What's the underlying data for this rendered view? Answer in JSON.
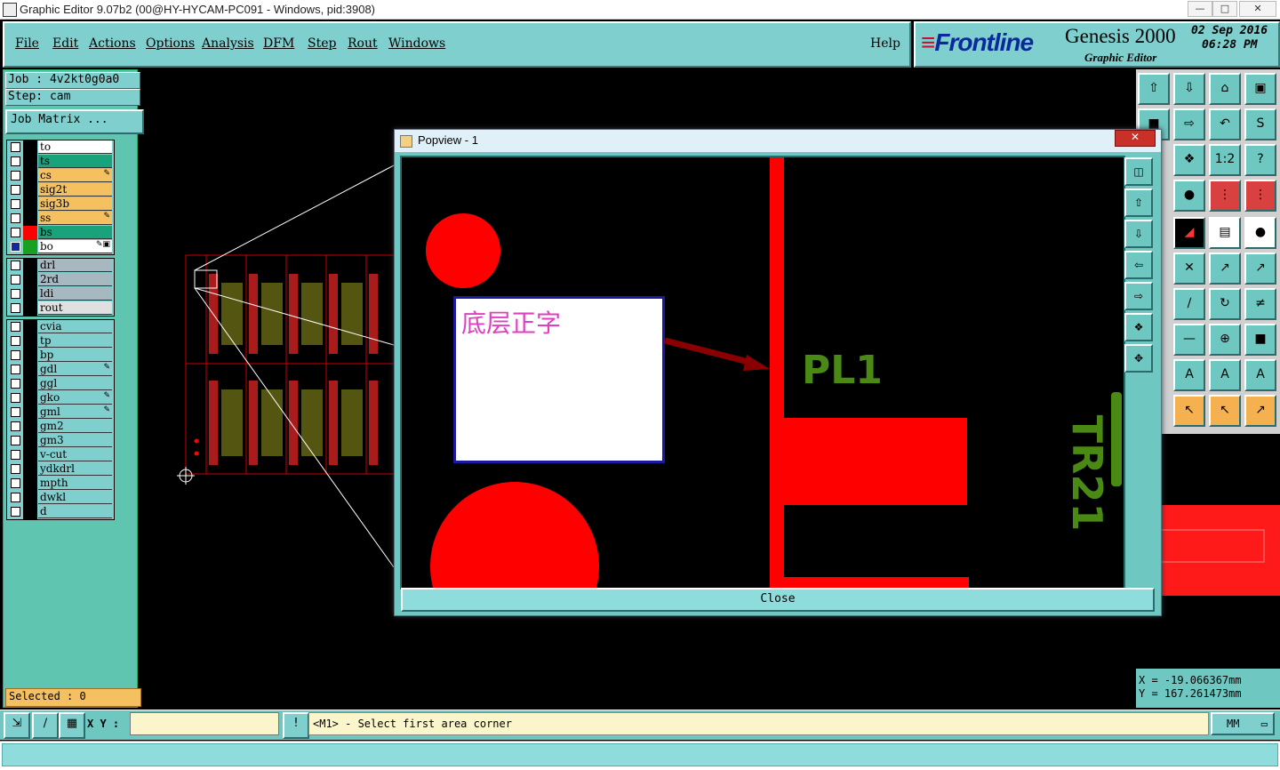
{
  "window": {
    "title": "Graphic Editor 9.07b2 (00@HY-HYCAM-PC091 - Windows, pid:3908)",
    "buttons": [
      "—",
      "□",
      "✕"
    ]
  },
  "menu": {
    "items": [
      "File",
      "Edit",
      "Actions",
      "Options",
      "Analysis",
      "DFM",
      "Step",
      "Rout",
      "Windows"
    ],
    "help": "Help"
  },
  "brand": {
    "logo": "Frontline",
    "product": "Genesis 2000",
    "subtitle": "Graphic Editor",
    "date": "02 Sep 2016",
    "time": "06:28 PM"
  },
  "job": {
    "job_label": "Job : 4v2kt0g0a0",
    "step_label": "Step: cam",
    "matrix_button": "Job Matrix ..."
  },
  "layers": {
    "group1": [
      {
        "name": "to",
        "color": "#ffffff",
        "edit": ""
      },
      {
        "name": "ts",
        "color": "#1aa37a",
        "edit": ""
      },
      {
        "name": "cs",
        "color": "#f5c060",
        "edit": "✎"
      },
      {
        "name": "sig2t",
        "color": "#f5c060",
        "edit": ""
      },
      {
        "name": "sig3b",
        "color": "#f5c060",
        "edit": ""
      },
      {
        "name": "ss",
        "color": "#f5c060",
        "edit": "✎"
      },
      {
        "name": "bs",
        "color": "#1aa37a",
        "edit": ""
      },
      {
        "name": "bo",
        "color": "#ffffff",
        "edit": "✎▣"
      }
    ],
    "group2": [
      {
        "name": "drl",
        "color": "#a8b8c0",
        "edit": ""
      },
      {
        "name": "2rd",
        "color": "#a8b8c0",
        "edit": ""
      },
      {
        "name": "ldi",
        "color": "#a8b8c0",
        "edit": ""
      },
      {
        "name": "rout",
        "color": "#e0e0e0",
        "edit": ""
      }
    ],
    "group3": [
      {
        "name": "cvia",
        "color": "#8fdcdc",
        "edit": ""
      },
      {
        "name": "tp",
        "color": "#8fdcdc",
        "edit": ""
      },
      {
        "name": "bp",
        "color": "#8fdcdc",
        "edit": ""
      },
      {
        "name": "gdl",
        "color": "#8fdcdc",
        "edit": "✎"
      },
      {
        "name": "ggl",
        "color": "#8fdcdc",
        "edit": ""
      },
      {
        "name": "gko",
        "color": "#8fdcdc",
        "edit": "✎"
      },
      {
        "name": "gml",
        "color": "#8fdcdc",
        "edit": "✎"
      },
      {
        "name": "gm2",
        "color": "#8fdcdc",
        "edit": ""
      },
      {
        "name": "gm3",
        "color": "#8fdcdc",
        "edit": ""
      },
      {
        "name": "v-cut",
        "color": "#8fdcdc",
        "edit": ""
      },
      {
        "name": "ydkdrl",
        "color": "#8fdcdc",
        "edit": ""
      },
      {
        "name": "mpth",
        "color": "#8fdcdc",
        "edit": ""
      },
      {
        "name": "dwkl",
        "color": "#8fdcdc",
        "edit": ""
      },
      {
        "name": "d",
        "color": "#8fdcdc",
        "edit": ""
      }
    ],
    "bs_swatch": "#ff0000",
    "bo_swatch": "#1aa020",
    "bo_box": "#102a9a"
  },
  "selected": "Selected : 0",
  "status": {
    "xy_label": "X Y :",
    "xy_value": "",
    "prompt": "<M1> - Select first area corner",
    "units": "MM",
    "warn_icon": "!"
  },
  "coords": {
    "x": "X = -19.066367mm",
    "y": "Y = 167.261473mm"
  },
  "popview": {
    "title": "Popview - 1",
    "close_button": "Close",
    "note_text": "底层正字",
    "label_pl1": "PL1",
    "label_tr21": "TR21"
  },
  "colors": {
    "panel": "#6ec7c0",
    "copper": "#ff0000",
    "silk": "#4a8a14",
    "note_text": "#e040c0"
  }
}
